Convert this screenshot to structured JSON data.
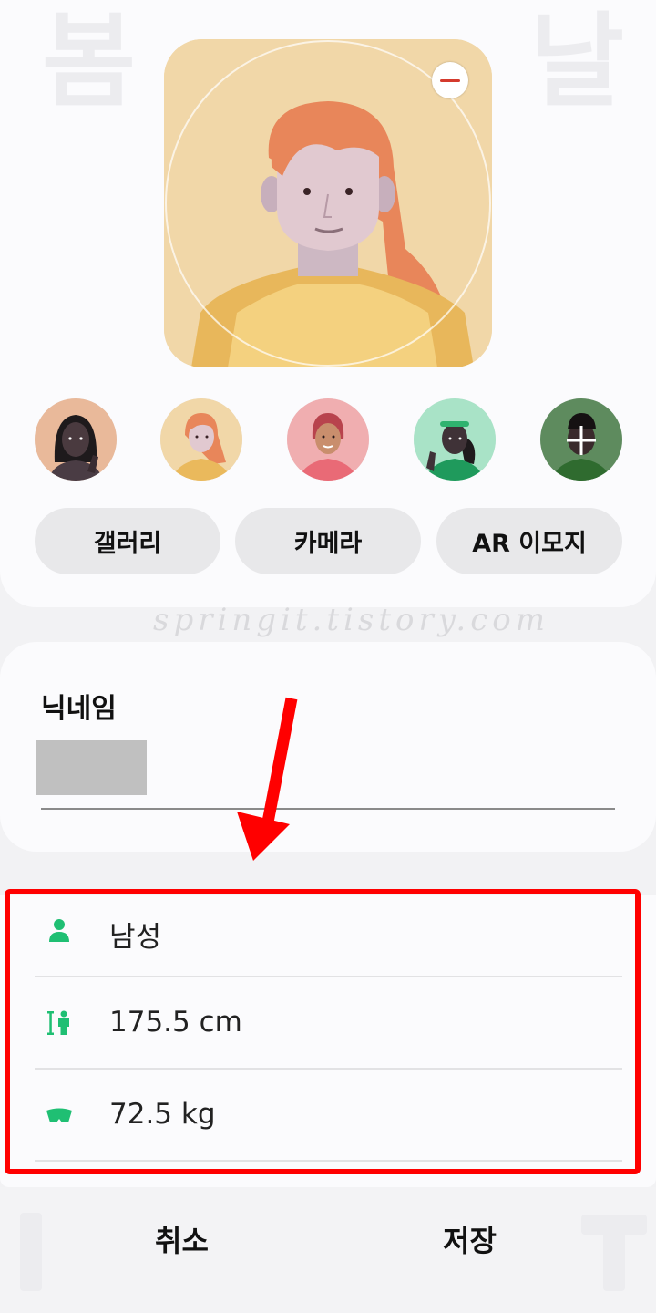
{
  "background_glyphs": [
    "봄",
    "날"
  ],
  "avatar": {
    "main_alt": "selected-avatar",
    "remove_icon": "minus-icon",
    "thumbnails": [
      {
        "name": "avatar-option-1",
        "skin": "#4a3a3f",
        "bg": "#e9b99a"
      },
      {
        "name": "avatar-option-2",
        "skin": "#e1c9cf",
        "bg": "#f1d7a8"
      },
      {
        "name": "avatar-option-3",
        "skin": "#c98e6d",
        "bg": "#f0aeb0"
      },
      {
        "name": "avatar-option-4",
        "skin": "#3f3237",
        "bg": "#a9e3c7"
      },
      {
        "name": "avatar-option-5",
        "skin": "#3a2a2c",
        "bg": "#5e8b5e"
      }
    ]
  },
  "buttons": {
    "gallery": "갤러리",
    "camera": "카메라",
    "ar_emoji": "AR 이모지"
  },
  "watermark": "springit.tistory.com",
  "nickname": {
    "title": "닉네임"
  },
  "profile": {
    "gender": {
      "icon": "person-icon",
      "value": "남성"
    },
    "height": {
      "icon": "height-icon",
      "value": "175.5 cm"
    },
    "weight": {
      "icon": "weight-icon",
      "value": "72.5 kg"
    }
  },
  "footer": {
    "cancel": "취소",
    "save": "저장"
  },
  "colors": {
    "accent_green": "#1fbf73",
    "highlight_red": "#ff0000"
  }
}
